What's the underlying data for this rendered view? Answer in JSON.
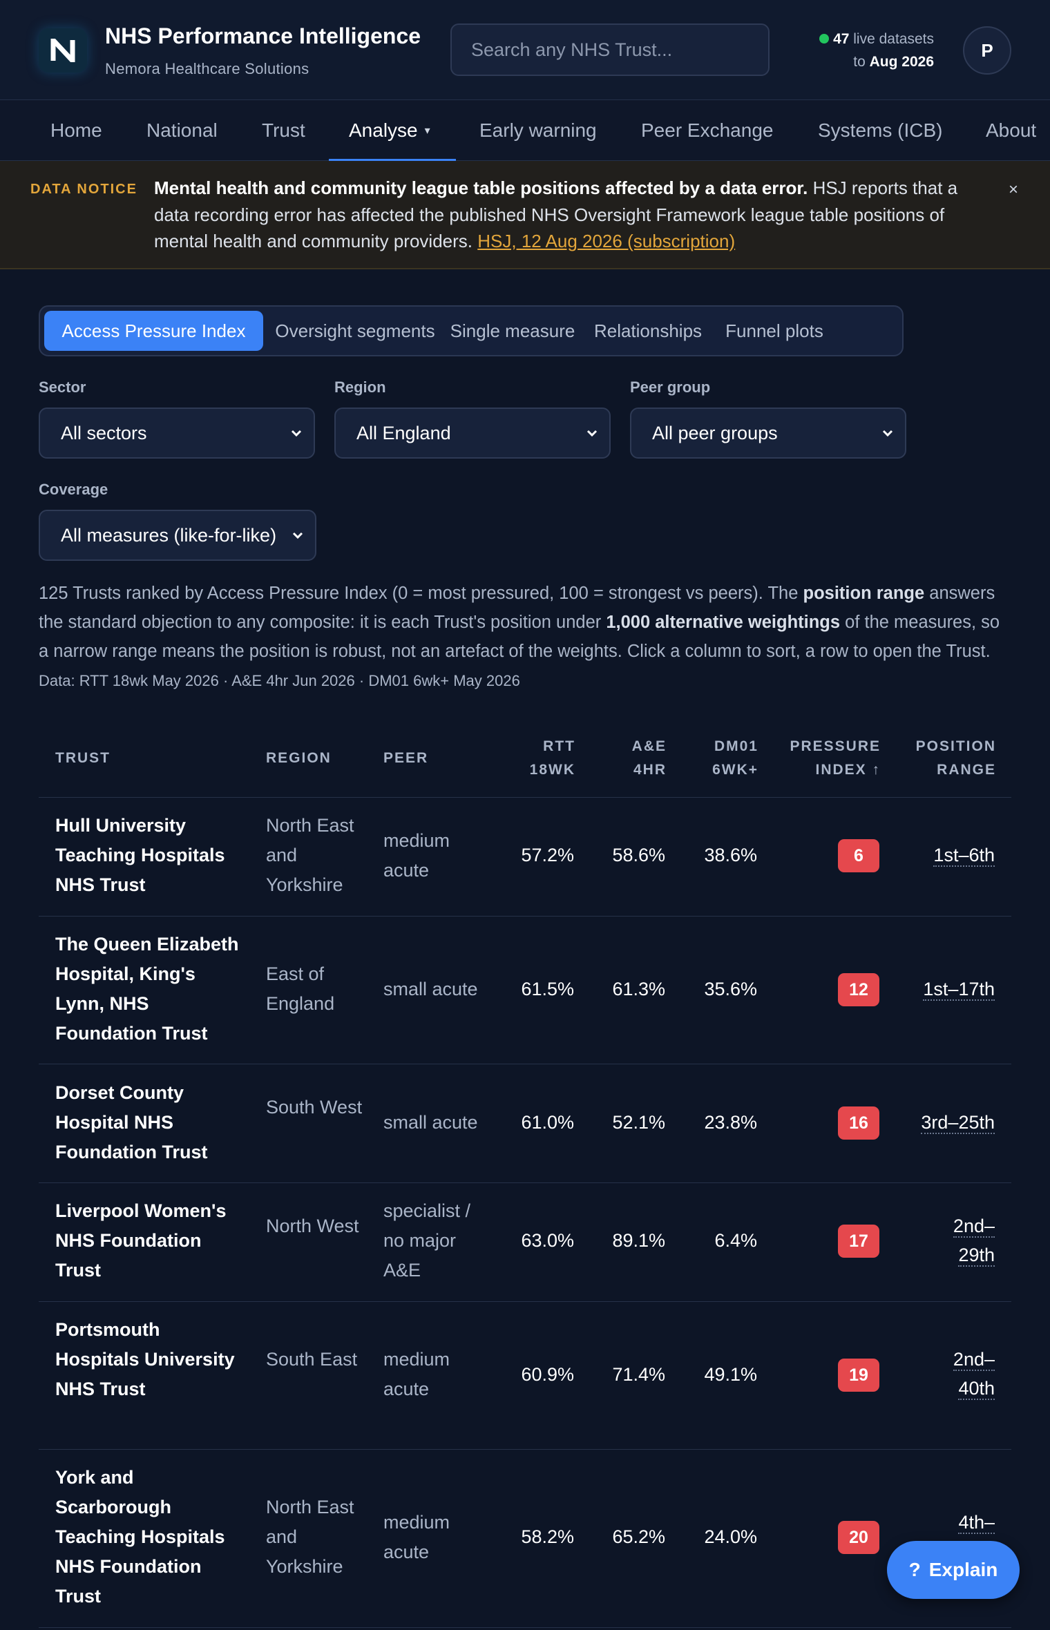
{
  "header": {
    "brand_title": "NHS Performance Intelligence",
    "brand_subtitle": "Nemora Healthcare Solutions",
    "logo_letter": "N",
    "search_placeholder": "Search any NHS Trust...",
    "live_count": "47",
    "live_label": "live datasets",
    "live_to": "to",
    "live_date": "Aug 2026",
    "avatar_initial": "P"
  },
  "nav": {
    "items": [
      "Home",
      "National",
      "Trust",
      "Analyse",
      "Early warning",
      "Peer Exchange",
      "Systems (ICB)",
      "About"
    ],
    "active": "Analyse"
  },
  "notice": {
    "tag": "DATA NOTICE",
    "headline": "Mental health and community league table positions affected by a data error.",
    "body": "HSJ reports that a data recording error has affected the published NHS Oversight Framework league table positions of mental health and community providers.",
    "link_text": "HSJ, 12 Aug 2026 (subscription)",
    "close": "×"
  },
  "tabs": [
    "Access Pressure Index",
    "Oversight segments",
    "Single measure",
    "Relationships",
    "Funnel plots"
  ],
  "filters": {
    "sector": {
      "label": "Sector",
      "value": "All sectors"
    },
    "region": {
      "label": "Region",
      "value": "All England"
    },
    "peer": {
      "label": "Peer group",
      "value": "All peer groups"
    },
    "coverage": {
      "label": "Coverage",
      "value": "All measures (like-for-like)"
    }
  },
  "description": {
    "p1": "125 Trusts ranked by Access Pressure Index (0 = most pressured, 100 = strongest vs peers). The ",
    "b1": "position range",
    "p2": " answers the standard objection to any composite: it is each Trust's position under ",
    "b2": "1,000 alternative weightings",
    "p3": " of the measures, so a narrow range means the position is robust, not an artefact of the weights. Click a column to sort, a row to open the Trust. ",
    "source": "Data: RTT 18wk May 2026 · A&E 4hr Jun 2026 · DM01 6wk+ May 2026"
  },
  "table": {
    "headers": {
      "trust": "TRUST",
      "region": "REGION",
      "peer": "PEER",
      "rtt_1": "RTT",
      "rtt_2": "18WK",
      "ae_1": "A&E",
      "ae_2": "4HR",
      "dm_1": "DM01",
      "dm_2": "6WK+",
      "pi_1": "PRESSURE",
      "pi_2": "INDEX ↑",
      "pr_1": "POSITION",
      "pr_2": "RANGE"
    },
    "rows": [
      {
        "trust": "Hull University Teaching Hospitals NHS Trust",
        "region": "North East and Yorkshire",
        "peer": "medium acute",
        "rtt": "57.2%",
        "ae": "58.6%",
        "dm": "38.6%",
        "index": "6",
        "range": "1st–6th"
      },
      {
        "trust": "The Queen Elizabeth Hospital, King's Lynn, NHS Foundation Trust",
        "region": "East of England",
        "peer": "small acute",
        "rtt": "61.5%",
        "ae": "61.3%",
        "dm": "35.6%",
        "index": "12",
        "range": "1st–17th"
      },
      {
        "trust": "Dorset County Hospital NHS Foundation Trust",
        "region": "South West",
        "peer": "small acute",
        "rtt": "61.0%",
        "ae": "52.1%",
        "dm": "23.8%",
        "index": "16",
        "range": "3rd–25th"
      },
      {
        "trust": "Liverpool Women's NHS Foundation Trust",
        "region": "North West",
        "peer": "specialist / no major A&E",
        "rtt": "63.0%",
        "ae": "89.1%",
        "dm": "6.4%",
        "index": "17",
        "range": "2nd–29th"
      },
      {
        "trust": "Portsmouth Hospitals University NHS Trust",
        "region": "South East",
        "peer": "medium acute",
        "rtt": "60.9%",
        "ae": "71.4%",
        "dm": "49.1%",
        "index": "19",
        "range": "2nd–40th"
      },
      {
        "trust": "York and Scarborough Teaching Hospitals NHS Foundation Trust",
        "region": "North East and Yorkshire",
        "peer": "medium acute",
        "rtt": "58.2%",
        "ae": "65.2%",
        "dm": "24.0%",
        "index": "20",
        "range": "4th–"
      }
    ]
  },
  "explain_button": {
    "icon": "?",
    "label": "Explain"
  },
  "colors": {
    "background": "#0d1526",
    "accent": "#3b82f6",
    "notice": "#e3a63b",
    "badge": "#e5484d",
    "live": "#22c55e"
  }
}
